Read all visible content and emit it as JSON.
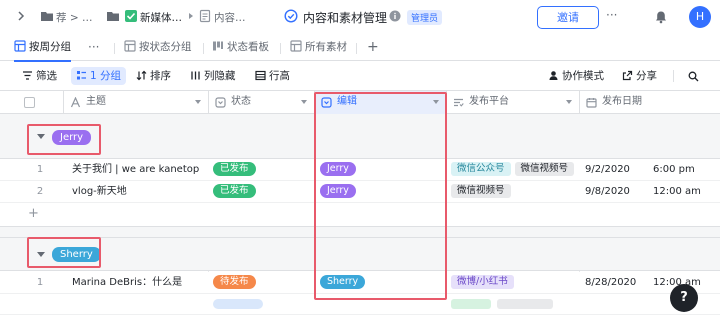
{
  "topbar": {
    "crumb1": "荐 > …",
    "crumb2": "新媒体…",
    "crumb3": "内容…",
    "title": "内容和素材管理",
    "role_badge": "管理员",
    "invite": "邀请",
    "more": "···",
    "avatar": "H"
  },
  "tabs": [
    {
      "label": "按周分组"
    },
    {
      "label": "按状态分组"
    },
    {
      "label": "状态看板"
    },
    {
      "label": "所有素材"
    }
  ],
  "tab_more": "···",
  "tab_add": "+",
  "toolbar": {
    "filter": "筛选",
    "group": "1 分组",
    "sort": "排序",
    "hide": "列隐藏",
    "row_height": "行高",
    "collab": "协作模式",
    "share": "分享"
  },
  "columns": {
    "topic": "主题",
    "status": "状态",
    "editor": "编辑",
    "platform": "发布平台",
    "date": "发布日期"
  },
  "groups": [
    {
      "name": "Jerry",
      "rows": [
        {
          "num": "1",
          "topic": "关于我们 | we are kanetop",
          "status": "已发布",
          "editor": "Jerry",
          "platforms": [
            "微信公众号",
            "微信视频号"
          ],
          "date": "9/2/2020",
          "time": "6:00 pm"
        },
        {
          "num": "2",
          "topic": "vlog-新天地",
          "status": "已发布",
          "editor": "Jerry",
          "platforms": [
            "微信视频号"
          ],
          "date": "9/8/2020",
          "time": "12:00 am"
        }
      ],
      "add": "+"
    },
    {
      "name": "Sherry",
      "rows": [
        {
          "num": "1",
          "topic": "Marina DeBris：什么是",
          "status": "待发布",
          "editor": "Sherry",
          "platforms": [
            "微博/小红书"
          ],
          "date": "8/28/2020",
          "time": "12:00 am"
        }
      ]
    }
  ],
  "help": "?",
  "colors": {
    "accent": "#3370ff",
    "jerry": "#9a6ff0",
    "sherry": "#3ba7d9",
    "published": "#35bd7b",
    "pending": "#f5884a",
    "highlight": "#e85a6b"
  }
}
